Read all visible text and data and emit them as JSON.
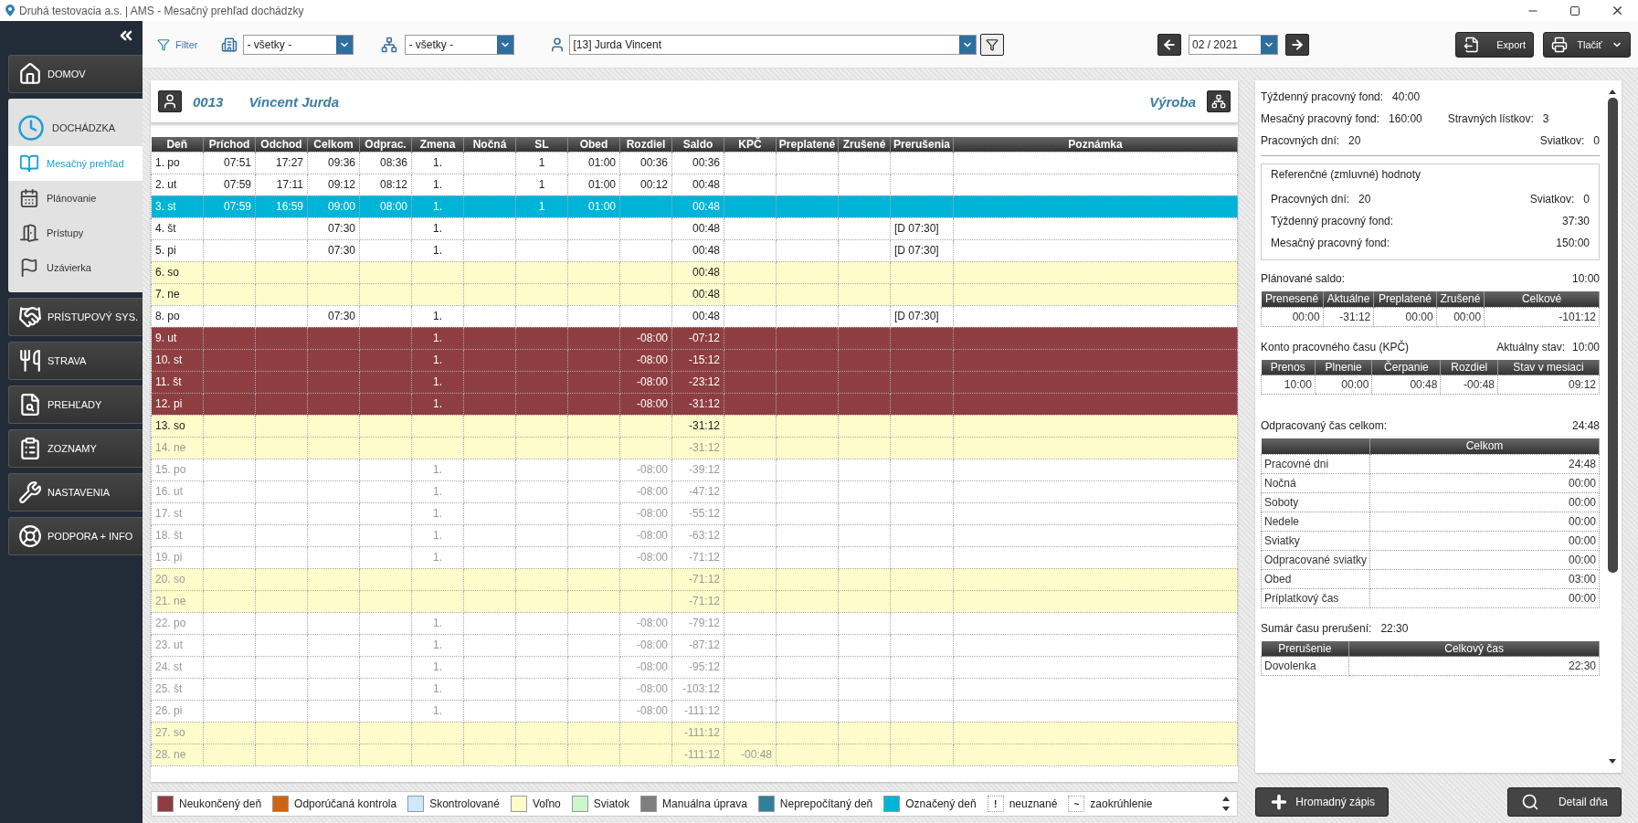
{
  "window": {
    "title": "Druhá testovacia a.s. | AMS - Mesačný prehľad dochádzky"
  },
  "sidebar": {
    "items": [
      {
        "kind": "button",
        "label": "DOMOV",
        "selected": false
      },
      {
        "kind": "group",
        "label": "DOCHÁDZKA",
        "expanded": true,
        "children": [
          {
            "label": "Mesačný prehľad",
            "selected": true
          },
          {
            "label": "Plánovanie",
            "selected": false
          },
          {
            "label": "Prístupy",
            "selected": false
          },
          {
            "label": "Uzávierka",
            "selected": false
          }
        ]
      },
      {
        "kind": "button",
        "label": "PRÍSTUPOVÝ SYS.",
        "selected": false
      },
      {
        "kind": "button",
        "label": "STRAVA",
        "selected": false
      },
      {
        "kind": "button",
        "label": "PREHĽADY",
        "selected": false
      },
      {
        "kind": "button",
        "label": "ZOZNAMY",
        "selected": false
      },
      {
        "kind": "button",
        "label": "NASTAVENIA",
        "selected": false
      },
      {
        "kind": "button",
        "label": "PODPORA + INFO",
        "selected": false
      }
    ]
  },
  "toolbar": {
    "filter_label": "Filter",
    "department": {
      "value": "- všetky -"
    },
    "team": {
      "value": "- všetky -"
    },
    "employee": {
      "value": "[13] Jurda Vincent"
    },
    "period": {
      "value": "02 / 2021"
    },
    "buttons": [
      {
        "kind": "export",
        "label": "Export"
      },
      {
        "kind": "print",
        "label": "Tlačiť"
      }
    ]
  },
  "employee_header": {
    "number": "0013",
    "name": "Vincent Jurda",
    "department": "Výroba"
  },
  "table": {
    "columns": [
      "Deň",
      "Príchod",
      "Odchod",
      "Celkom",
      "Odprac.",
      "Zmena",
      "Nočná",
      "SL",
      "Obed",
      "Rozdiel",
      "Saldo",
      "KPČ",
      "Preplatené",
      "Zrušené",
      "Prerušenia",
      "Poznámka"
    ],
    "rows": [
      {
        "kind": "workday",
        "selected": false,
        "dimmed": false,
        "cells": [
          "1. po",
          "07:51",
          "17:27",
          "09:36",
          "08:36",
          "1.",
          null,
          "1",
          "01:00",
          "00:36",
          "00:36",
          null,
          null,
          null,
          null,
          null
        ]
      },
      {
        "kind": "workday",
        "selected": false,
        "dimmed": false,
        "cells": [
          "2. ut",
          "07:59",
          "17:11",
          "09:12",
          "08:12",
          "1.",
          null,
          "1",
          "01:00",
          "00:12",
          "00:48",
          null,
          null,
          null,
          null,
          null
        ]
      },
      {
        "kind": "workday",
        "selected": true,
        "dimmed": false,
        "cells": [
          "3. st",
          "07:59",
          "16:59",
          "09:00",
          "08:00",
          "1.",
          null,
          "1",
          "01:00",
          null,
          "00:48",
          null,
          null,
          null,
          null,
          null
        ]
      },
      {
        "kind": "workday",
        "selected": false,
        "dimmed": false,
        "cells": [
          "4. št",
          null,
          null,
          "07:30",
          null,
          "1.",
          null,
          null,
          null,
          null,
          "00:48",
          null,
          null,
          null,
          "[D 07:30]",
          null
        ]
      },
      {
        "kind": "workday",
        "selected": false,
        "dimmed": false,
        "cells": [
          "5. pi",
          null,
          null,
          "07:30",
          null,
          "1.",
          null,
          null,
          null,
          null,
          "00:48",
          null,
          null,
          null,
          "[D 07:30]",
          null
        ]
      },
      {
        "kind": "weekend",
        "selected": false,
        "dimmed": false,
        "cells": [
          "6. so",
          null,
          null,
          null,
          null,
          null,
          null,
          null,
          null,
          null,
          "00:48",
          null,
          null,
          null,
          null,
          null
        ]
      },
      {
        "kind": "weekend",
        "selected": false,
        "dimmed": false,
        "cells": [
          "7. ne",
          null,
          null,
          null,
          null,
          null,
          null,
          null,
          null,
          null,
          "00:48",
          null,
          null,
          null,
          null,
          null
        ]
      },
      {
        "kind": "workday",
        "selected": false,
        "dimmed": false,
        "cells": [
          "8. po",
          null,
          null,
          "07:30",
          null,
          "1.",
          null,
          null,
          null,
          null,
          "00:48",
          null,
          null,
          null,
          "[D 07:30]",
          null
        ]
      },
      {
        "kind": "unfinished",
        "selected": false,
        "dimmed": false,
        "cells": [
          "9. ut",
          null,
          null,
          null,
          null,
          "1.",
          null,
          null,
          null,
          "-08:00",
          "-07:12",
          null,
          null,
          null,
          null,
          null
        ]
      },
      {
        "kind": "unfinished",
        "selected": false,
        "dimmed": false,
        "cells": [
          "10. st",
          null,
          null,
          null,
          null,
          "1.",
          null,
          null,
          null,
          "-08:00",
          "-15:12",
          null,
          null,
          null,
          null,
          null
        ]
      },
      {
        "kind": "unfinished",
        "selected": false,
        "dimmed": false,
        "cells": [
          "11. št",
          null,
          null,
          null,
          null,
          "1.",
          null,
          null,
          null,
          "-08:00",
          "-23:12",
          null,
          null,
          null,
          null,
          null
        ]
      },
      {
        "kind": "unfinished",
        "selected": false,
        "dimmed": false,
        "cells": [
          "12. pi",
          null,
          null,
          null,
          null,
          "1.",
          null,
          null,
          null,
          "-08:00",
          "-31:12",
          null,
          null,
          null,
          null,
          null
        ]
      },
      {
        "kind": "weekend",
        "selected": false,
        "dimmed": false,
        "cells": [
          "13. so",
          null,
          null,
          null,
          null,
          null,
          null,
          null,
          null,
          null,
          "-31:12",
          null,
          null,
          null,
          null,
          null
        ]
      },
      {
        "kind": "weekend",
        "selected": false,
        "dimmed": true,
        "cells": [
          "14. ne",
          null,
          null,
          null,
          null,
          null,
          null,
          null,
          null,
          null,
          "-31:12",
          null,
          null,
          null,
          null,
          null
        ]
      },
      {
        "kind": "workday",
        "selected": false,
        "dimmed": true,
        "cells": [
          "15. po",
          null,
          null,
          null,
          null,
          "1.",
          null,
          null,
          null,
          "-08:00",
          "-39:12",
          null,
          null,
          null,
          null,
          null
        ]
      },
      {
        "kind": "workday",
        "selected": false,
        "dimmed": true,
        "cells": [
          "16. ut",
          null,
          null,
          null,
          null,
          "1.",
          null,
          null,
          null,
          "-08:00",
          "-47:12",
          null,
          null,
          null,
          null,
          null
        ]
      },
      {
        "kind": "workday",
        "selected": false,
        "dimmed": true,
        "cells": [
          "17. st",
          null,
          null,
          null,
          null,
          "1.",
          null,
          null,
          null,
          "-08:00",
          "-55:12",
          null,
          null,
          null,
          null,
          null
        ]
      },
      {
        "kind": "workday",
        "selected": false,
        "dimmed": true,
        "cells": [
          "18. št",
          null,
          null,
          null,
          null,
          "1.",
          null,
          null,
          null,
          "-08:00",
          "-63:12",
          null,
          null,
          null,
          null,
          null
        ]
      },
      {
        "kind": "workday",
        "selected": false,
        "dimmed": true,
        "cells": [
          "19. pi",
          null,
          null,
          null,
          null,
          "1.",
          null,
          null,
          null,
          "-08:00",
          "-71:12",
          null,
          null,
          null,
          null,
          null
        ]
      },
      {
        "kind": "weekend",
        "selected": false,
        "dimmed": true,
        "cells": [
          "20. so",
          null,
          null,
          null,
          null,
          null,
          null,
          null,
          null,
          null,
          "-71:12",
          null,
          null,
          null,
          null,
          null
        ]
      },
      {
        "kind": "weekend",
        "selected": false,
        "dimmed": true,
        "cells": [
          "21. ne",
          null,
          null,
          null,
          null,
          null,
          null,
          null,
          null,
          null,
          "-71:12",
          null,
          null,
          null,
          null,
          null
        ]
      },
      {
        "kind": "workday",
        "selected": false,
        "dimmed": true,
        "cells": [
          "22. po",
          null,
          null,
          null,
          null,
          "1.",
          null,
          null,
          null,
          "-08:00",
          "-79:12",
          null,
          null,
          null,
          null,
          null
        ]
      },
      {
        "kind": "workday",
        "selected": false,
        "dimmed": true,
        "cells": [
          "23. ut",
          null,
          null,
          null,
          null,
          "1.",
          null,
          null,
          null,
          "-08:00",
          "-87:12",
          null,
          null,
          null,
          null,
          null
        ]
      },
      {
        "kind": "workday",
        "selected": false,
        "dimmed": true,
        "cells": [
          "24. st",
          null,
          null,
          null,
          null,
          "1.",
          null,
          null,
          null,
          "-08:00",
          "-95:12",
          null,
          null,
          null,
          null,
          null
        ]
      },
      {
        "kind": "workday",
        "selected": false,
        "dimmed": true,
        "cells": [
          "25. št",
          null,
          null,
          null,
          null,
          "1.",
          null,
          null,
          null,
          "-08:00",
          "-103:12",
          null,
          null,
          null,
          null,
          null
        ]
      },
      {
        "kind": "workday",
        "selected": false,
        "dimmed": true,
        "cells": [
          "26. pi",
          null,
          null,
          null,
          null,
          "1.",
          null,
          null,
          null,
          "-08:00",
          "-111:12",
          null,
          null,
          null,
          null,
          null
        ]
      },
      {
        "kind": "weekend",
        "selected": false,
        "dimmed": true,
        "cells": [
          "27. so",
          null,
          null,
          null,
          null,
          null,
          null,
          null,
          null,
          null,
          "-111:12",
          null,
          null,
          null,
          null,
          null
        ]
      },
      {
        "kind": "weekend",
        "selected": false,
        "dimmed": true,
        "cells": [
          "28. ne",
          null,
          null,
          null,
          null,
          null,
          null,
          null,
          null,
          null,
          "-111:12",
          "-00:48",
          null,
          null,
          null,
          null
        ]
      }
    ]
  },
  "legend": [
    {
      "kind": "swatch",
      "label": "Neukončený deň",
      "color": "#8e3e41"
    },
    {
      "kind": "swatch",
      "label": "Odporúčaná kontrola",
      "color": "#cc6616"
    },
    {
      "kind": "swatch",
      "label": "Skontrolované",
      "color": "#cce8fa"
    },
    {
      "kind": "swatch",
      "label": "Voľno",
      "color": "#fffccc"
    },
    {
      "kind": "swatch",
      "label": "Sviatok",
      "color": "#ccf7cc"
    },
    {
      "kind": "swatch",
      "label": "Manuálna úprava",
      "color": "#7f7f7f"
    },
    {
      "kind": "swatch",
      "label": "Neprepočítaný deň",
      "color": "#337f99"
    },
    {
      "kind": "swatch",
      "label": "Označený deň",
      "color": "#00b4d8"
    },
    {
      "kind": "glyph",
      "glyph": "!",
      "label": "neuznané"
    },
    {
      "kind": "glyph",
      "glyph": "~",
      "label": "zaokrúhlenie"
    }
  ],
  "summary": {
    "weekly_fund": {
      "label": "Týždenný pracovný fond:",
      "value": "40:00"
    },
    "monthly_fund": {
      "label": "Mesačný pracovný fond:",
      "value": "160:00"
    },
    "meal_tickets": {
      "label": "Stravných lístkov:",
      "value": "3"
    },
    "working_days": {
      "label": "Pracovných dní:",
      "value": "20"
    },
    "holidays": {
      "label": "Sviatkov:",
      "value": "0"
    },
    "reference": {
      "title": "Referenčné (zmluvné) hodnoty",
      "working_days": {
        "label": "Pracovných dní:",
        "value": "20"
      },
      "holidays": {
        "label": "Sviatkov:",
        "value": "0"
      },
      "weekly_fund": {
        "label": "Týždenný pracovný fond:",
        "value": "37:30"
      },
      "monthly_fund": {
        "label": "Mesačný pracovný fond:",
        "value": "150:00"
      }
    },
    "planned_balance": {
      "label": "Plánované saldo:",
      "value": "10:00",
      "table": {
        "columns": [
          "Prenesené",
          "Aktuálne",
          "Preplatené",
          "Zrušené",
          "Celkové"
        ],
        "rows": [
          [
            "00:00",
            "-31:12",
            "00:00",
            "00:00",
            "-101:12"
          ]
        ]
      }
    },
    "kpc": {
      "title": "Konto pracovného času (KPČ)",
      "state": {
        "label": "Aktuálny stav:",
        "value": "10:00"
      },
      "table": {
        "columns": [
          "Prenos",
          "Plnenie",
          "Čerpanie",
          "Rozdiel",
          "Stav v mesiaci"
        ],
        "rows": [
          [
            "10:00",
            "00:00",
            "00:48",
            "-00:48",
            "09:12"
          ]
        ]
      }
    },
    "worked_total": {
      "label": "Odpracovaný čas celkom:",
      "value": "24:48",
      "table": {
        "columns": [
          "",
          "Celkom"
        ],
        "rows": [
          [
            "Pracovné dni",
            "24:48"
          ],
          [
            "Nočná",
            "00:00"
          ],
          [
            "Soboty",
            "00:00"
          ],
          [
            "Nedele",
            "00:00"
          ],
          [
            "Sviatky",
            "00:00"
          ],
          [
            "Odpracované sviatky",
            "00:00"
          ],
          [
            "Obed",
            "03:00"
          ],
          [
            "Príplatkový čas",
            "00:00"
          ]
        ]
      }
    },
    "interruptions": {
      "label": "Sumár času prerušení:",
      "value": "22:30",
      "table": {
        "columns": [
          "Prerušenie",
          "Celkový čas"
        ],
        "rows": [
          [
            "Dovolenka",
            "22:30"
          ]
        ]
      }
    }
  },
  "actions": [
    {
      "kind": "add",
      "label": "Hromadný zápis"
    },
    {
      "kind": "detail",
      "label": "Detail dňa"
    }
  ]
}
